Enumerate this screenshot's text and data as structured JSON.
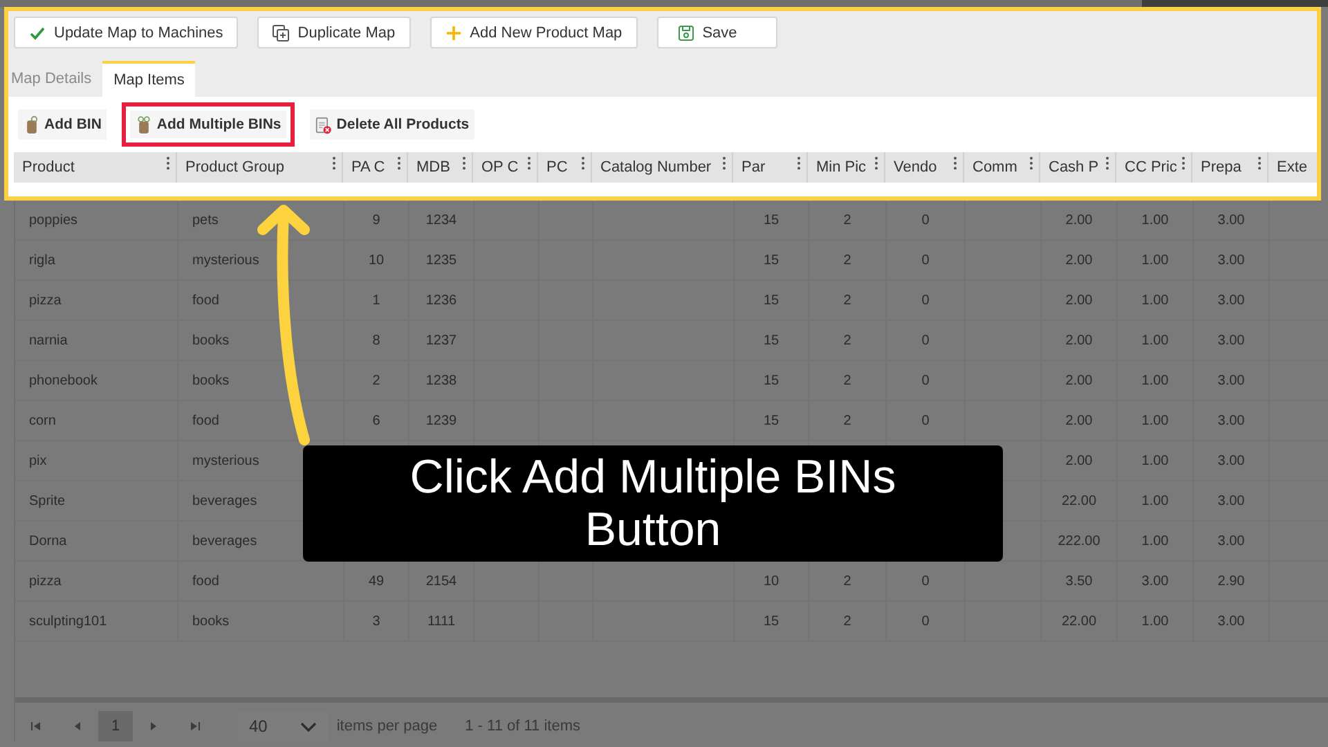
{
  "toolbar": {
    "buttons": [
      {
        "label": "Update Map to Machines",
        "kind": "check"
      },
      {
        "label": "Duplicate Map",
        "kind": "duplicate"
      },
      {
        "label": "Add New Product Map",
        "kind": "plus"
      },
      {
        "label": "Save",
        "kind": "save"
      }
    ]
  },
  "tabs": [
    {
      "label": "Map Details",
      "selected": false
    },
    {
      "label": "Map Items",
      "selected": true
    }
  ],
  "grid_toolbar": {
    "buttons": [
      {
        "label": "Add BIN",
        "kind": "bin",
        "highlighted": false
      },
      {
        "label": "Add Multiple BINs",
        "kind": "bins",
        "highlighted": true
      },
      {
        "label": "Delete All Products",
        "kind": "delete",
        "highlighted": false
      }
    ]
  },
  "table": {
    "columns": [
      "Product",
      "Product Group",
      "PA C",
      "MDB",
      "OP C",
      "PC",
      "Catalog Number",
      "Par",
      "Min Pic",
      "Vendo",
      "Comm",
      "Cash P",
      "CC Pric",
      "Prepa",
      "Exte"
    ],
    "rows": [
      [
        "poppies",
        "pets",
        "9",
        "1234",
        null,
        null,
        null,
        "15",
        "2",
        "0",
        null,
        "2.00",
        "1.00",
        "3.00",
        null
      ],
      [
        "rigla",
        "mysterious",
        "10",
        "1235",
        null,
        null,
        null,
        "15",
        "2",
        "0",
        null,
        "2.00",
        "1.00",
        "3.00",
        null
      ],
      [
        "pizza",
        "food",
        "1",
        "1236",
        null,
        null,
        null,
        "15",
        "2",
        "0",
        null,
        "2.00",
        "1.00",
        "3.00",
        null
      ],
      [
        "narnia",
        "books",
        "8",
        "1237",
        null,
        null,
        null,
        "15",
        "2",
        "0",
        null,
        "2.00",
        "1.00",
        "3.00",
        null
      ],
      [
        "phonebook",
        "books",
        "2",
        "1238",
        null,
        null,
        null,
        "15",
        "2",
        "0",
        null,
        "2.00",
        "1.00",
        "3.00",
        null
      ],
      [
        "corn",
        "food",
        "6",
        "1239",
        null,
        null,
        null,
        "15",
        "2",
        "0",
        null,
        "2.00",
        "1.00",
        "3.00",
        null
      ],
      [
        "pix",
        "mysterious",
        null,
        null,
        null,
        null,
        null,
        null,
        null,
        null,
        null,
        "2.00",
        "1.00",
        "3.00",
        null
      ],
      [
        "Sprite",
        "beverages",
        null,
        null,
        null,
        null,
        null,
        null,
        null,
        null,
        null,
        "22.00",
        "1.00",
        "3.00",
        null
      ],
      [
        "Dorna",
        "beverages",
        null,
        null,
        null,
        null,
        null,
        null,
        null,
        null,
        null,
        "222.00",
        "1.00",
        "3.00",
        null
      ],
      [
        "pizza",
        "food",
        "49",
        "2154",
        null,
        null,
        null,
        "10",
        "2",
        "0",
        null,
        "3.50",
        "3.00",
        "2.90",
        null
      ],
      [
        "sculpting101",
        "books",
        "3",
        "1111",
        null,
        null,
        null,
        "15",
        "2",
        "0",
        null,
        "22.00",
        "1.00",
        "3.00",
        null
      ]
    ]
  },
  "pager": {
    "pages": [
      {
        "label": "1",
        "selected": true
      }
    ],
    "page_size": "40",
    "page_size_label": "items per page",
    "summary": "1 - 11 of 11 items"
  },
  "callout": {
    "text": "Click Add Multiple BINs Button"
  }
}
